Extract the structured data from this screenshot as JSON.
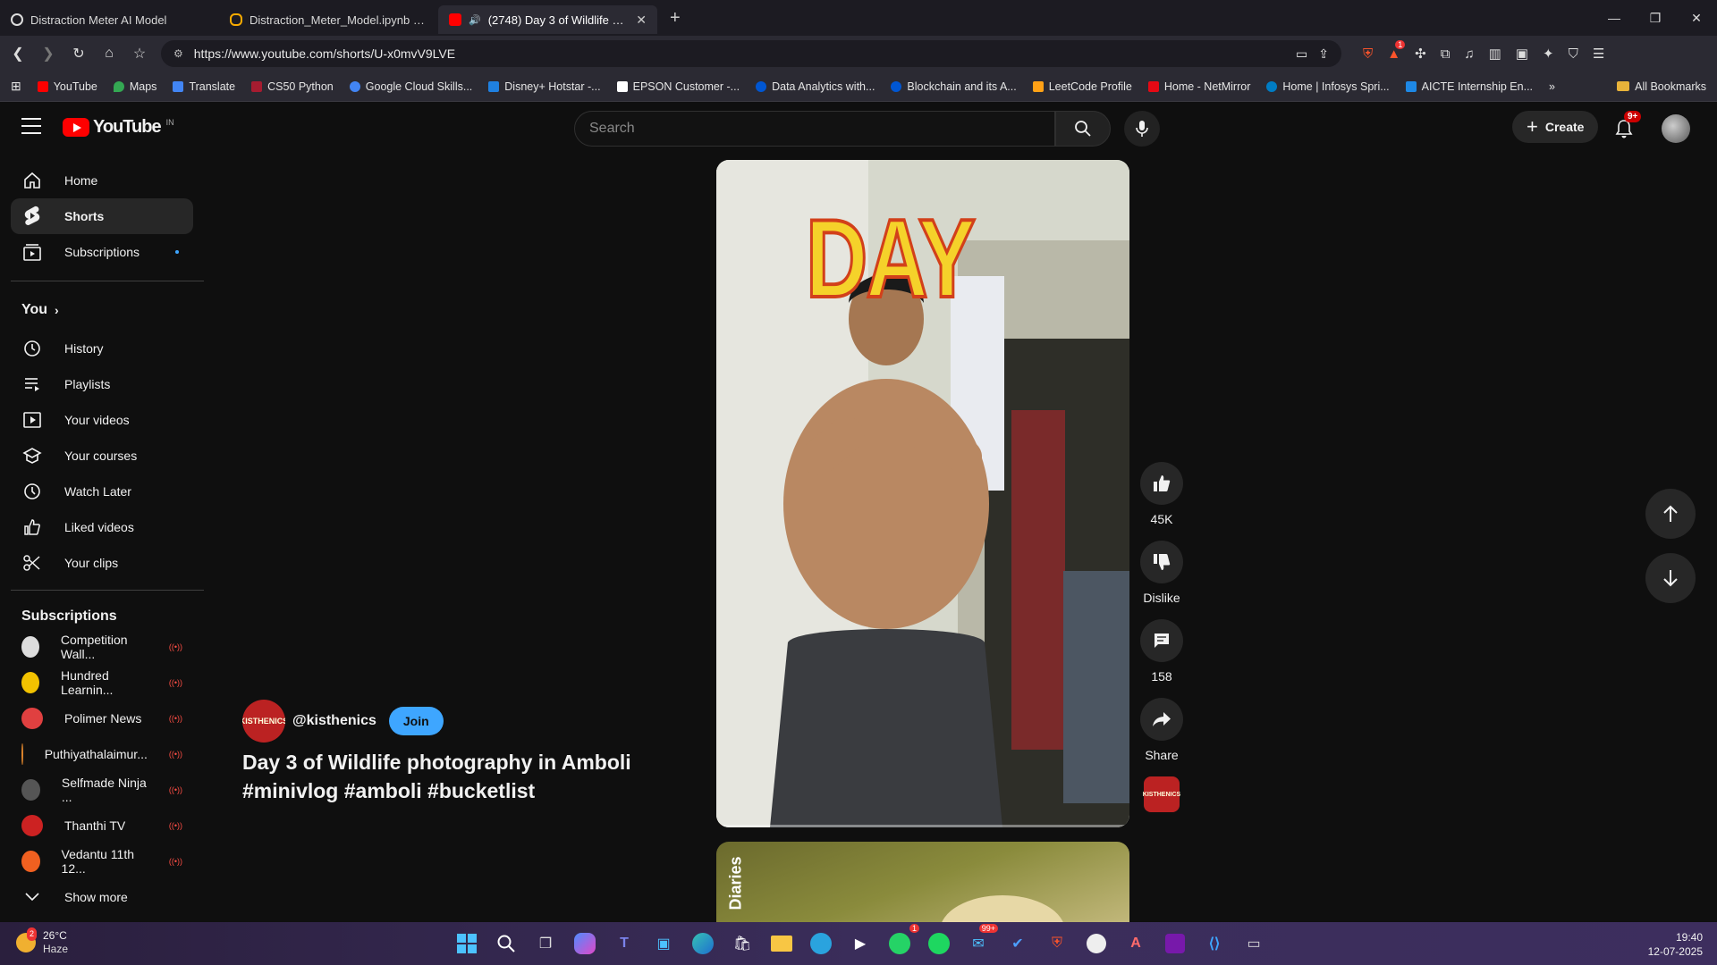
{
  "browser": {
    "tabs": [
      {
        "label": "Distraction Meter AI Model",
        "icon_color": "#e0e0e0",
        "active": false
      },
      {
        "label": "Distraction_Meter_Model.ipynb - Col",
        "icon_color": "#f9ab00",
        "active": false
      },
      {
        "label": "(2748) Day 3 of Wildlife photo",
        "icon_color": "#ff0000",
        "active": true
      }
    ],
    "url": "https://www.youtube.com/shorts/U-x0mvV9LVE",
    "extension_badge": "1",
    "bookmarks": [
      {
        "label": "YouTube",
        "color": "#ff0000"
      },
      {
        "label": "Maps",
        "color": "#34a853"
      },
      {
        "label": "Translate",
        "color": "#4285f4"
      },
      {
        "label": "CS50 Python",
        "color": "#a51c30"
      },
      {
        "label": "Google Cloud Skills...",
        "color": "#4285f4"
      },
      {
        "label": "Disney+ Hotstar -...",
        "color": "#1f80e0"
      },
      {
        "label": "EPSON Customer -...",
        "color": "#ffffff"
      },
      {
        "label": "Data Analytics with...",
        "color": "#0056d2"
      },
      {
        "label": "Blockchain and its A...",
        "color": "#0056d2"
      },
      {
        "label": "LeetCode Profile",
        "color": "#ffa116"
      },
      {
        "label": "Home - NetMirror",
        "color": "#e50914"
      },
      {
        "label": "Home | Infosys Spri...",
        "color": "#007cc3"
      },
      {
        "label": "AICTE Internship En...",
        "color": "#1e88e5"
      }
    ],
    "all_bookmarks": "All Bookmarks"
  },
  "youtube": {
    "logo_text": "YouTube",
    "country": "IN",
    "search_placeholder": "Search",
    "create_label": "Create",
    "notif_badge": "9+"
  },
  "sidebar": {
    "main": [
      {
        "label": "Home",
        "icon": "home-icon"
      },
      {
        "label": "Shorts",
        "icon": "shorts-icon"
      },
      {
        "label": "Subscriptions",
        "icon": "subscriptions-icon"
      }
    ],
    "you_heading": "You",
    "you_items": [
      {
        "label": "History",
        "icon": "history-icon"
      },
      {
        "label": "Playlists",
        "icon": "playlists-icon"
      },
      {
        "label": "Your videos",
        "icon": "your-videos-icon"
      },
      {
        "label": "Your courses",
        "icon": "courses-icon"
      },
      {
        "label": "Watch Later",
        "icon": "watch-later-icon"
      },
      {
        "label": "Liked videos",
        "icon": "liked-icon"
      },
      {
        "label": "Your clips",
        "icon": "clips-icon"
      }
    ],
    "subs_heading": "Subscriptions",
    "subscriptions": [
      {
        "label": "Competition Wall...",
        "color": "#dddddd"
      },
      {
        "label": "Hundred Learnin...",
        "color": "#f2c200"
      },
      {
        "label": "Polimer News",
        "color": "#e04040"
      },
      {
        "label": "Puthiyathalaimur...",
        "color": "#d9822b"
      },
      {
        "label": "Selfmade Ninja ...",
        "color": "#333333"
      },
      {
        "label": "Thanthi TV",
        "color": "#cc2222"
      },
      {
        "label": "Vedantu 11th 12...",
        "color": "#f06020"
      }
    ],
    "show_more": "Show more"
  },
  "short": {
    "overlay_text": "DAY",
    "channel": "@kisthenics",
    "channel_avatar_text": "KISTHENICS",
    "join_label": "Join",
    "title": "Day 3 of Wildlife photography in Amboli #minivlog #amboli #bucketlist",
    "likes": "45K",
    "dislike_label": "Dislike",
    "comments": "158",
    "share_label": "Share",
    "next_overlay_text": "Diaries"
  },
  "taskbar": {
    "temp": "26°C",
    "weather": "Haze",
    "weather_badge": "2",
    "whatsapp_badge": "1",
    "mail_badge": "99+",
    "time": "19:40",
    "date": "12-07-2025"
  }
}
